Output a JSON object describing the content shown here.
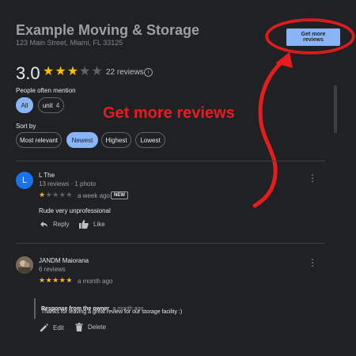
{
  "business": {
    "title": "Example Moving & Storage",
    "address": "123 Main Street, Miami, FL 33125"
  },
  "cta": {
    "label": "Get more reviews"
  },
  "rating": {
    "value": "3.0",
    "stars": 3,
    "count_text": "22 reviews",
    "info_icon": "i"
  },
  "mentions": {
    "label": "People often mention",
    "chips": [
      {
        "label": "All",
        "count": "",
        "selected": true
      },
      {
        "label": "unit",
        "count": "4",
        "selected": false
      }
    ]
  },
  "sort": {
    "label": "Sort by",
    "options": [
      {
        "label": "Most relevant",
        "selected": false
      },
      {
        "label": "Newest",
        "selected": true
      },
      {
        "label": "Highest",
        "selected": false
      },
      {
        "label": "Lowest",
        "selected": false
      }
    ]
  },
  "annotation": {
    "text": "Get more reviews",
    "color": "#e81c1c"
  },
  "reviews": [
    {
      "avatar_letter": "L",
      "avatar_color": "#1a73e8",
      "name": "L The",
      "sub": "13 reviews · 1 photo",
      "stars": 1,
      "date": "a week ago",
      "badge": "NEW",
      "text": "Rude very unprofessional",
      "actions": [
        "Reply",
        "Like"
      ]
    },
    {
      "avatar_letter": "",
      "avatar_color": "#6b5d4e",
      "name": "JANDM Maiorana",
      "sub": "6 reviews",
      "stars": 5,
      "date": "a month ago",
      "owner_response": {
        "title": "Response from the owner",
        "date": "a month ago",
        "text": "Thanks for leaving a great review for our storage facility :)"
      },
      "actions": [
        "Edit",
        "Delete"
      ]
    }
  ],
  "colors": {
    "accent": "#8ab4f8",
    "star": "#fbbc04",
    "background": "#202124"
  }
}
